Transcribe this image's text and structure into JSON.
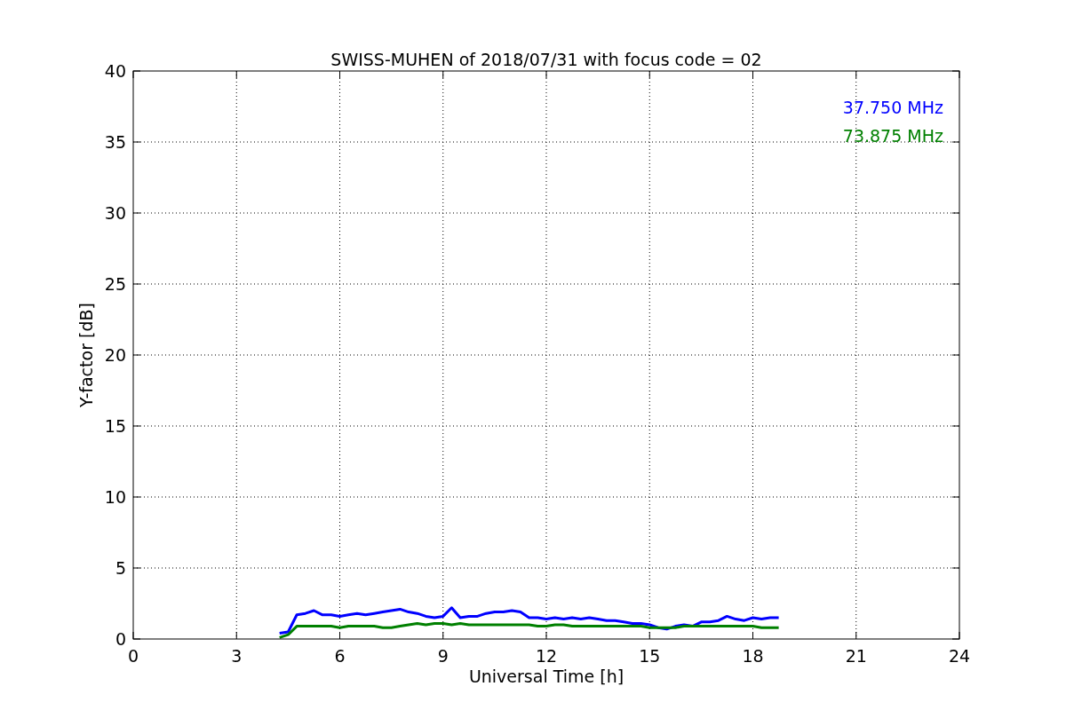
{
  "chart_data": {
    "type": "line",
    "title": "SWISS-MUHEN of 2018/07/31 with focus code = 02",
    "xlabel": "Universal Time [h]",
    "ylabel": "Y-factor [dB]",
    "x": [
      4.25,
      4.5,
      4.75,
      5,
      5.25,
      5.5,
      5.75,
      6,
      6.25,
      6.5,
      6.75,
      7,
      7.25,
      7.5,
      7.75,
      8,
      8.25,
      8.5,
      8.75,
      9,
      9.25,
      9.5,
      9.75,
      10,
      10.25,
      10.5,
      10.75,
      11,
      11.25,
      11.5,
      11.75,
      12,
      12.25,
      12.5,
      12.75,
      13,
      13.25,
      13.5,
      13.75,
      14,
      14.25,
      14.5,
      14.75,
      15,
      15.25,
      15.5,
      15.75,
      16,
      16.25,
      16.5,
      16.75,
      17,
      17.25,
      17.5,
      17.75,
      18,
      18.25,
      18.5,
      18.75
    ],
    "series": [
      {
        "name": "37.750 MHz",
        "color": "#0000ff",
        "values": [
          0.4,
          0.5,
          1.7,
          1.8,
          2.0,
          1.7,
          1.7,
          1.6,
          1.7,
          1.8,
          1.7,
          1.8,
          1.9,
          2.0,
          2.1,
          1.9,
          1.8,
          1.6,
          1.5,
          1.6,
          2.2,
          1.5,
          1.6,
          1.6,
          1.8,
          1.9,
          1.9,
          2.0,
          1.9,
          1.5,
          1.5,
          1.4,
          1.5,
          1.4,
          1.5,
          1.4,
          1.5,
          1.4,
          1.3,
          1.3,
          1.2,
          1.1,
          1.1,
          1.0,
          0.8,
          0.7,
          0.9,
          1.0,
          0.9,
          1.2,
          1.2,
          1.3,
          1.6,
          1.4,
          1.3,
          1.5,
          1.4,
          1.5,
          1.5
        ]
      },
      {
        "name": "73.875 MHz",
        "color": "#008000",
        "values": [
          0.1,
          0.3,
          0.9,
          0.9,
          0.9,
          0.9,
          0.9,
          0.8,
          0.9,
          0.9,
          0.9,
          0.9,
          0.8,
          0.8,
          0.9,
          1.0,
          1.1,
          1.0,
          1.1,
          1.1,
          1.0,
          1.1,
          1.0,
          1.0,
          1.0,
          1.0,
          1.0,
          1.0,
          1.0,
          1.0,
          0.9,
          0.9,
          1.0,
          1.0,
          0.9,
          0.9,
          0.9,
          0.9,
          0.9,
          0.9,
          0.9,
          0.9,
          0.9,
          0.8,
          0.8,
          0.8,
          0.8,
          0.9,
          0.9,
          0.9,
          0.9,
          0.9,
          0.9,
          0.9,
          0.9,
          0.9,
          0.8,
          0.8,
          0.8
        ]
      }
    ],
    "grid": true,
    "xlim": [
      0,
      24
    ],
    "ylim": [
      0,
      40
    ],
    "xticks": [
      0,
      3,
      6,
      9,
      12,
      15,
      18,
      21,
      24
    ],
    "yticks": [
      0,
      5,
      10,
      15,
      20,
      25,
      30,
      35,
      40
    ]
  }
}
